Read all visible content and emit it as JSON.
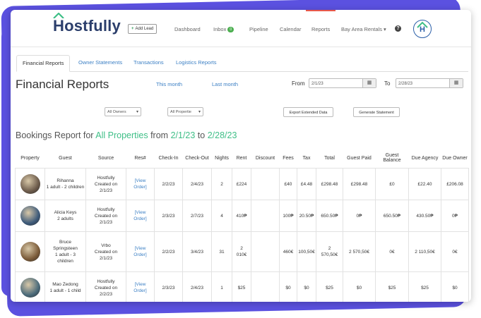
{
  "colors": {
    "accent": "#3fbf87",
    "link": "#3b7fc4",
    "brand": "#2b3e6b",
    "background_shape": "#5b51e0"
  },
  "header": {
    "logo_text": "Hostfully",
    "add_lead_label": "Add Lead",
    "nav": [
      {
        "label": "Dashboard"
      },
      {
        "label": "Inbox",
        "badge": "0"
      },
      {
        "label": "Pipeline"
      },
      {
        "label": "Calendar"
      },
      {
        "label": "Reports"
      },
      {
        "label": "Bay Area Rentals"
      }
    ],
    "help_icon": "?",
    "avatar_letter": "H"
  },
  "tabs": [
    "Financial Reports",
    "Owner Statements",
    "Transactions",
    "Logistics Reports"
  ],
  "page_title": "Financial Reports",
  "quick_links": {
    "this_month": "This month",
    "last_month": "Last month"
  },
  "date_range": {
    "from_label": "From",
    "from_value": "2/1/23",
    "to_label": "To",
    "to_value": "2/28/23",
    "calendar_icon": "▦"
  },
  "filters": {
    "owners": "All Owners",
    "properties": "All Propertie"
  },
  "actions": {
    "export": "Export Extended Data",
    "statement": "Generate Statement"
  },
  "report_heading": {
    "prefix": "Bookings Report for ",
    "scope": "All Properties",
    "mid": " from ",
    "start": "2/1/23",
    "to": " to ",
    "end": "2/28/23"
  },
  "table": {
    "columns": [
      "Property",
      "Guest",
      "Source",
      "Res#",
      "Check-In",
      "Check-Out",
      "Nights",
      "Rent",
      "Discount",
      "Fees",
      "Tax",
      "Total",
      "Guest Paid",
      "Guest Balance",
      "Due Agency",
      "Due Owner"
    ],
    "rows": [
      {
        "photo": "#6b5a4a",
        "guest": "Rihanna\n1 adult - 2 children",
        "source": "Hostfully\nCreated on\n2/1/23",
        "res": "[View\nOrder]",
        "checkin": "2/2/23",
        "checkout": "2/4/23",
        "nights": "2",
        "rent": "£224",
        "discount": "",
        "fees": "£40",
        "tax": "£4.48",
        "total": "£298.48",
        "paid": "£298.48",
        "balance": "£0",
        "agency": "£22.40",
        "owner": "£206.08"
      },
      {
        "photo": "#3d5a7a",
        "guest": "Alicia Keys\n2 adults",
        "source": "Hostfully\nCreated on\n2/1/23",
        "res": "[View\nOrder]",
        "checkin": "2/3/23",
        "checkout": "2/7/23",
        "nights": "4",
        "rent": "410₱",
        "discount": "",
        "fees": "100₱",
        "tax": "20.50₱",
        "total": "650.50₱",
        "paid": "0₱",
        "balance": "650.50₱",
        "agency": "430.50₱",
        "owner": "0₱"
      },
      {
        "photo": "#7a5a38",
        "guest": "Bruce\nSpringsteen\n1 adult - 3\nchildren",
        "source": "Vrbo\nCreated on\n2/1/23",
        "res": "[View\nOrder]",
        "checkin": "2/2/23",
        "checkout": "3/4/23",
        "nights": "31",
        "rent": "2\n010€",
        "discount": "",
        "fees": "460€",
        "tax": "100,50€",
        "total": "2\n570,50€",
        "paid": "2 570,50€",
        "balance": "0€",
        "agency": "2 110,50€",
        "owner": "0€"
      },
      {
        "photo": "#4a6a7a",
        "guest": "Mao Zedong\n1 adult - 1 child",
        "source": "Hostfully\nCreated on\n2/2/23",
        "res": "[View\nOrder]",
        "checkin": "2/3/23",
        "checkout": "2/4/23",
        "nights": "1",
        "rent": "$25",
        "discount": "",
        "fees": "$0",
        "tax": "$0",
        "total": "$25",
        "paid": "$0",
        "balance": "$25",
        "agency": "$25",
        "owner": "$0"
      }
    ]
  }
}
